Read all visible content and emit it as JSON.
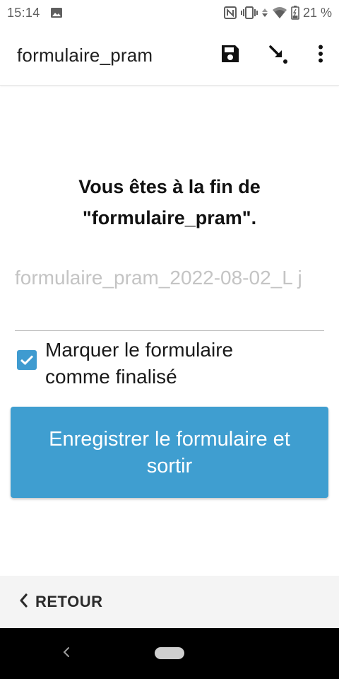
{
  "status_bar": {
    "time": "15:14",
    "battery": "21 %",
    "icons": [
      "image-icon",
      "nfc-icon",
      "vibrate-icon",
      "data-arrows-icon",
      "wifi-icon",
      "battery-icon"
    ]
  },
  "app_bar": {
    "title": "formulaire_pram",
    "actions": [
      "save-icon",
      "jump-icon",
      "more-vert-icon"
    ]
  },
  "content": {
    "heading": "Vous êtes à la fin de \"formulaire_pram\".",
    "instance_name_value": "formulaire_pram_2022-08-02_L j",
    "finalize_checked": true,
    "finalize_label": "Marquer le formulaire comme finalisé",
    "save_button_label": "Enregistrer le formulaire et sortir"
  },
  "bottom_nav": {
    "back_label": "RETOUR"
  },
  "colors": {
    "accent": "#3f9ed0",
    "checkbox": "#3f9bd0",
    "nav_background": "#f4f4f4",
    "system_bar": "#000000"
  }
}
